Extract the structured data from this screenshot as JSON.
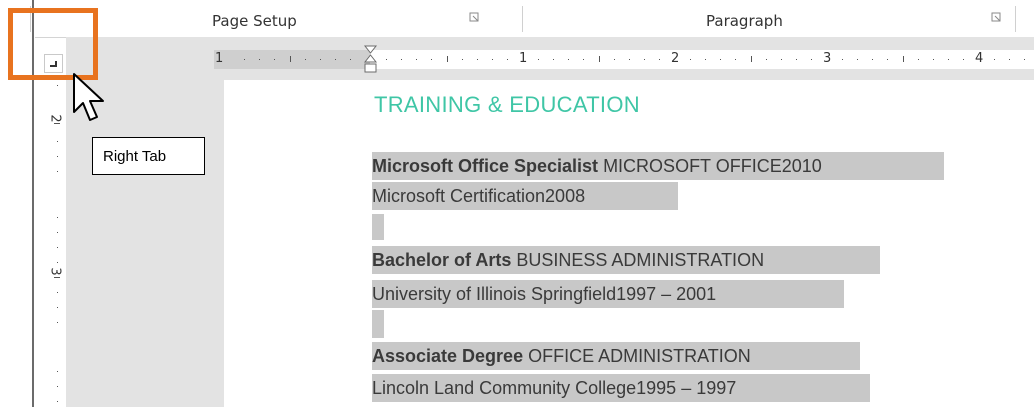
{
  "ribbon": {
    "groups": [
      {
        "label": "Page Setup"
      },
      {
        "label": "Paragraph"
      }
    ]
  },
  "ruler": {
    "tab_selector": "right-tab",
    "h_numbers": [
      "1",
      "1",
      "2",
      "3",
      "4"
    ],
    "v_numbers": [
      "2",
      "3"
    ]
  },
  "tooltip": {
    "text": "Right Tab"
  },
  "document": {
    "heading": "TRAINING & EDUCATION",
    "entries": [
      {
        "title": "Microsoft Office Specialist",
        "subtitle": " MICROSOFT OFFICE2010",
        "line2": "Microsoft Certification2008"
      },
      {
        "title": "Bachelor of Arts",
        "subtitle": " BUSINESS ADMINISTRATION",
        "line2": "University of Illinois Springfield1997 – 2001"
      },
      {
        "title": "Associate Degree",
        "subtitle": " OFFICE ADMINISTRATION",
        "line2": "Lincoln Land Community College1995 – 1997"
      }
    ]
  },
  "colors": {
    "callout_border": "#e8731f",
    "heading": "#3fc6a6",
    "selection": "#c8c8c8"
  }
}
